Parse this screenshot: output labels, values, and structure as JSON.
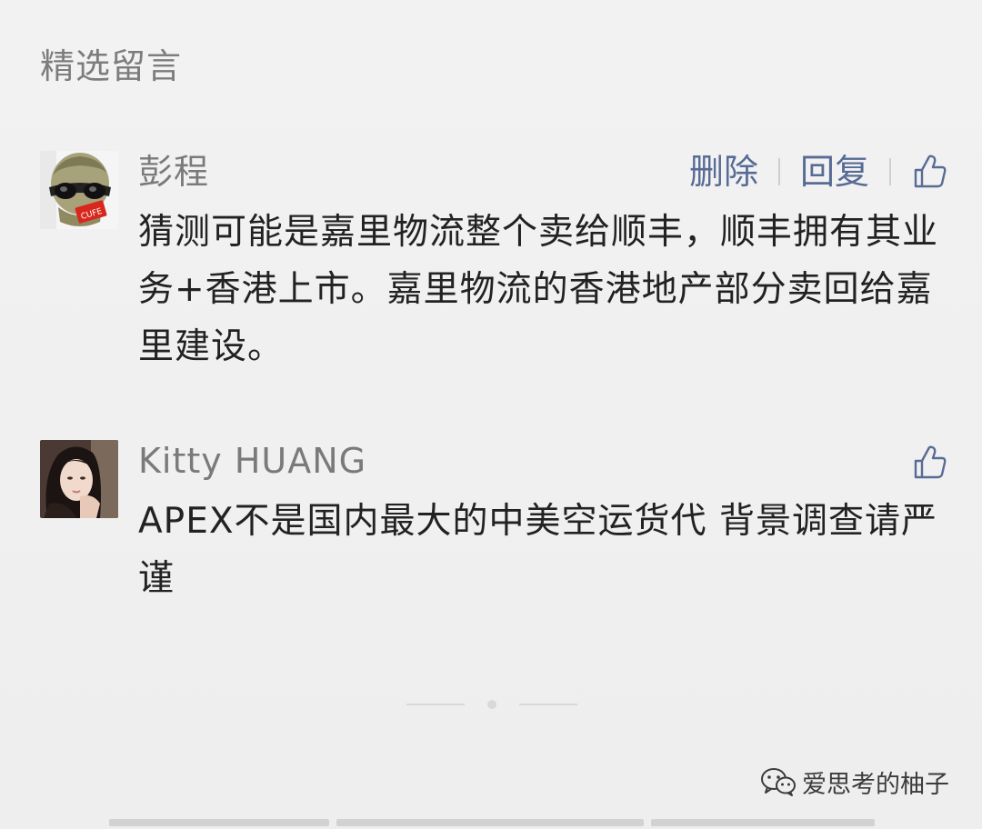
{
  "section": {
    "title": "精选留言"
  },
  "comments": [
    {
      "author": "彭程",
      "text": "猜测可能是嘉里物流整个卖给顺丰，顺丰拥有其业务+香港上市。嘉里物流的香港地产部分卖回给嘉里建设。",
      "actions": {
        "delete_label": "删除",
        "reply_label": "回复"
      },
      "like_icon": "thumbs-up-icon"
    },
    {
      "author": "Kitty HUANG",
      "text": "APEX不是国内最大的中美空运货代 背景调查请严谨",
      "like_icon": "thumbs-up-icon"
    }
  ],
  "watermark": {
    "label": "爱思考的柚子"
  },
  "colors": {
    "background": "#efefef",
    "link": "#576b95",
    "nickname": "#7a7a7a",
    "body_text": "#222222"
  }
}
